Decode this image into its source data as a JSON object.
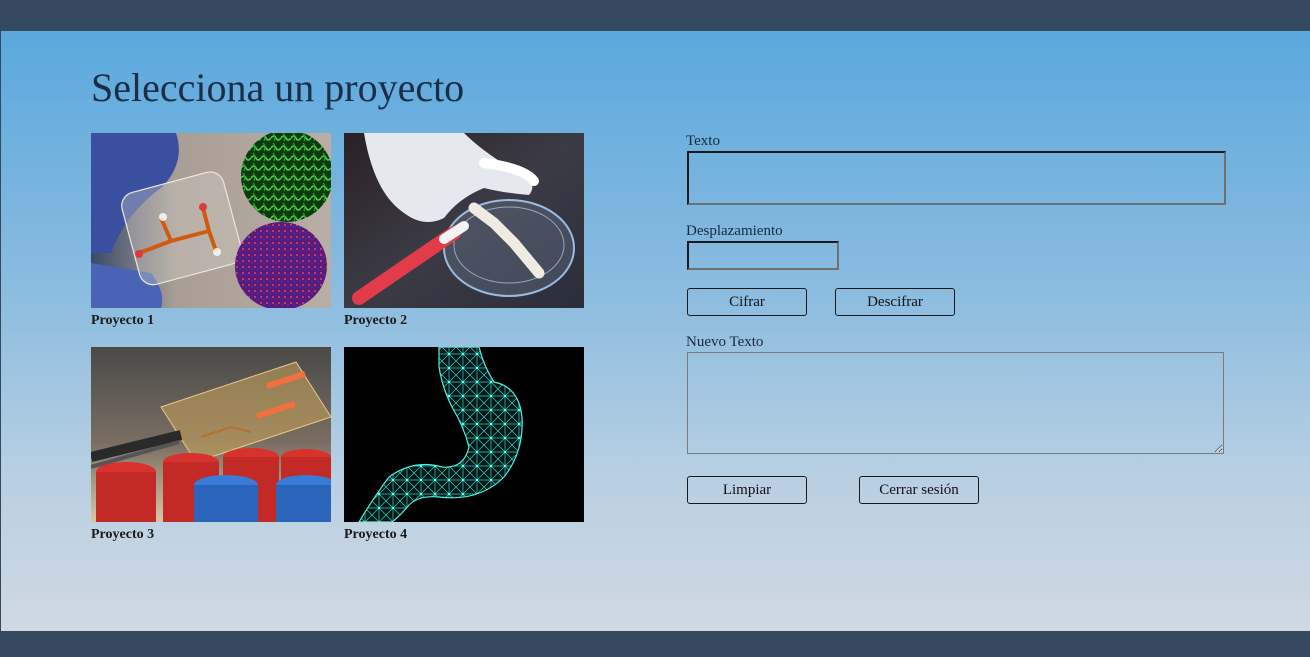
{
  "page": {
    "title": "Selecciona un proyecto"
  },
  "projects": [
    {
      "label": "Proyecto 1",
      "image": "microfluidic-chip-photo"
    },
    {
      "label": "Proyecto 2",
      "image": "petri-dish-photo"
    },
    {
      "label": "Proyecto 3",
      "image": "lab-chip-tweezers-photo"
    },
    {
      "label": "Proyecto 4",
      "image": "stomach-mesh-photo"
    }
  ],
  "form": {
    "texto_label": "Texto",
    "texto_value": "",
    "desplazamiento_label": "Desplazamiento",
    "desplazamiento_value": "",
    "cifrar_label": "Cifrar",
    "descifrar_label": "Descifrar",
    "nuevo_texto_label": "Nuevo Texto",
    "nuevo_texto_value": "",
    "limpiar_label": "Limpiar",
    "cerrar_sesion_label": "Cerrar sesión"
  },
  "colors": {
    "header_bar": "#34495e",
    "gradient_top": "#5aa8dd",
    "gradient_bottom": "#cfd9e2",
    "title_text": "#1c2e45"
  }
}
